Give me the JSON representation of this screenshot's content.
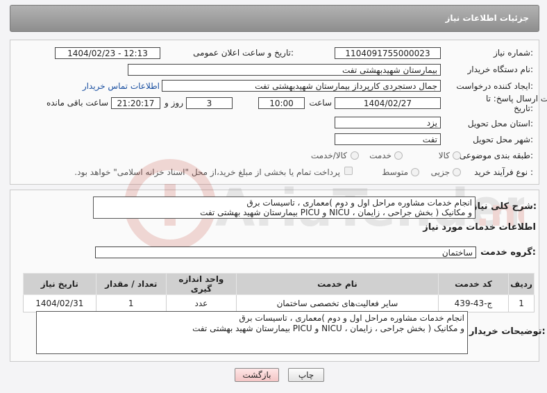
{
  "header": {
    "title": "جزئیات اطلاعات نیاز"
  },
  "form": {
    "need_number_label": "شماره نیاز:",
    "need_number": "1104091755000023",
    "announce_label": "تاریخ و ساعت اعلان عمومی:",
    "announce_value": "1404/02/23 - 12:13",
    "buyer_org_label": "نام دستگاه خریدار:",
    "buyer_org": "بیمارستان شهیدبهشتی تفت",
    "requester_label": "ایجاد کننده درخواست:",
    "requester": "جمال  دستجردی کارپرداز بیمارستان شهیدبهشتی تفت",
    "contact_link": "اطلاعات تماس خریدار",
    "deadline_label_1": "مهلت ارسال پاسخ: تا",
    "deadline_label_2": "تاریخ:",
    "deadline_date": "1404/02/27",
    "time_label": "ساعت",
    "deadline_time": "10:00",
    "days_value": "3",
    "days_label": "روز و",
    "remaining_time": "21:20:17",
    "remaining_label": "ساعت باقی مانده",
    "province_label": "استان محل تحویل:",
    "province": "یزد",
    "city_label": "شهر محل تحویل:",
    "city": "تفت",
    "category_label": "طبقه بندی موضوعی:",
    "category_options": [
      "کالا",
      "خدمت",
      "کالا/خدمت"
    ],
    "process_label": "نوع فرآیند خرید :",
    "process_options": [
      "جزیی",
      "متوسط"
    ],
    "payment_note": "پرداخت تمام یا بخشی از مبلغ خرید،از محل \"اسناد خزانه اسلامی\" خواهد بود."
  },
  "summary": {
    "label": "شرح کلی نیاز:",
    "line1": "انجام خدمات مشاوره مراحل اول و دوم )معماری ، تاسیسات برق",
    "line2": "و مکانیک ( بخش جراحی ، زایمان ، NICU و PICU بیمارستان شهید بهشتی تفت"
  },
  "services": {
    "section_title": "اطلاعات خدمات مورد نیاز",
    "group_label": "گروه خدمت:",
    "group_value": "ساختمان",
    "columns": [
      "ردیف",
      "کد خدمت",
      "نام خدمت",
      "واحد اندازه گیری",
      "تعداد / مقدار",
      "تاریخ نیاز"
    ],
    "rows": [
      [
        "1",
        "ج-43-439",
        "سایر فعالیت‌های تخصصی ساختمان",
        "عدد",
        "1",
        "1404/02/31"
      ]
    ]
  },
  "buyer_notes": {
    "label": "توضیحات خریدار:",
    "line1": "انجام خدمات مشاوره مراحل اول و دوم )معماری ، تاسیسات برق",
    "line2": "و مکانیک ( بخش جراحی ، زایمان ، NICU و PICU بیمارستان شهید بهشتی تفت"
  },
  "buttons": {
    "print": "چاپ",
    "back": "بازگشت"
  },
  "watermark": {
    "text": "AriaTender.neT"
  }
}
